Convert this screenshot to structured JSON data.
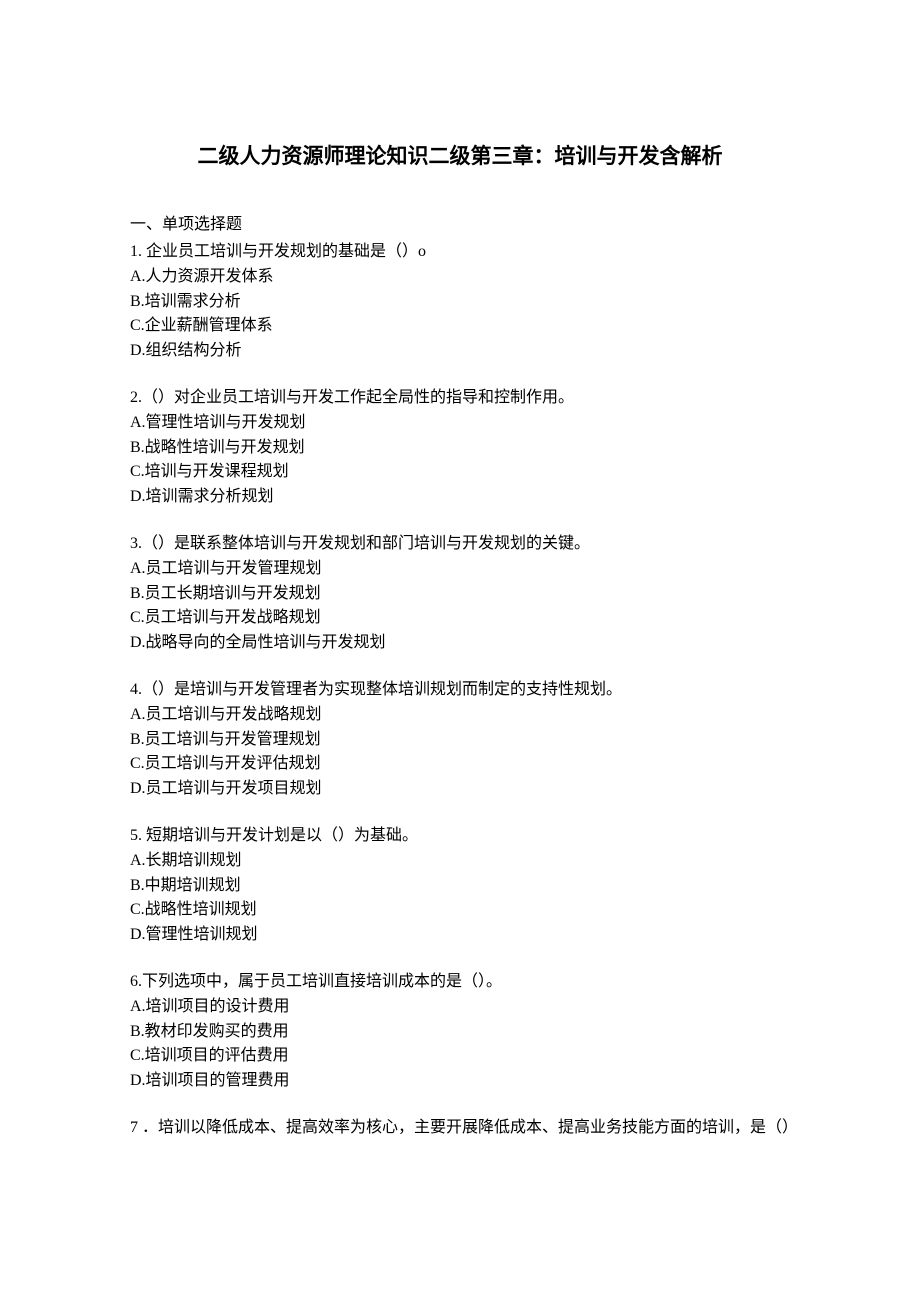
{
  "title": "二级人力资源师理论知识二级第三章：培训与开发含解析",
  "section_heading": "一、单项选择题",
  "questions": [
    {
      "stem": "1. 企业员工培训与开发规划的基础是（）o",
      "options": [
        "A.人力资源开发体系",
        "B.培训需求分析",
        "C.企业薪酬管理体系",
        "D.组织结构分析"
      ]
    },
    {
      "stem": "2.（）对企业员工培训与开发工作起全局性的指导和控制作用。",
      "options": [
        "A.管理性培训与开发规划",
        "B.战略性培训与开发规划",
        "C.培训与开发课程规划",
        "D.培训需求分析规划"
      ]
    },
    {
      "stem": "3.（）是联系整体培训与开发规划和部门培训与开发规划的关键。",
      "options": [
        "A.员工培训与开发管理规划",
        "B.员工长期培训与开发规划",
        "C.员工培训与开发战略规划",
        "D.战略导向的全局性培训与开发规划"
      ]
    },
    {
      "stem": "4.（）是培训与开发管理者为实现整体培训规划而制定的支持性规划。",
      "options": [
        "A.员工培训与开发战略规划",
        "B.员工培训与开发管理规划",
        "C.员工培训与开发评估规划",
        "D.员工培训与开发项目规划"
      ]
    },
    {
      "stem": "5. 短期培训与开发计划是以（）为基础。",
      "options": [
        "A.长期培训规划",
        "B.中期培训规划",
        "C.战略性培训规划",
        "D.管理性培训规划"
      ]
    },
    {
      "stem": "6.下列选项中，属于员工培训直接培训成本的是（）。",
      "options": [
        "A.培训项目的设计费用",
        "B.教材印发购买的费用",
        "C.培训项目的评估费用",
        "D.培训项目的管理费用"
      ]
    },
    {
      "stem": "7 ．培训以降低成本、提高效率为核心，主要开展降低成本、提高业务技能方面的培训，是（）",
      "options": []
    }
  ]
}
